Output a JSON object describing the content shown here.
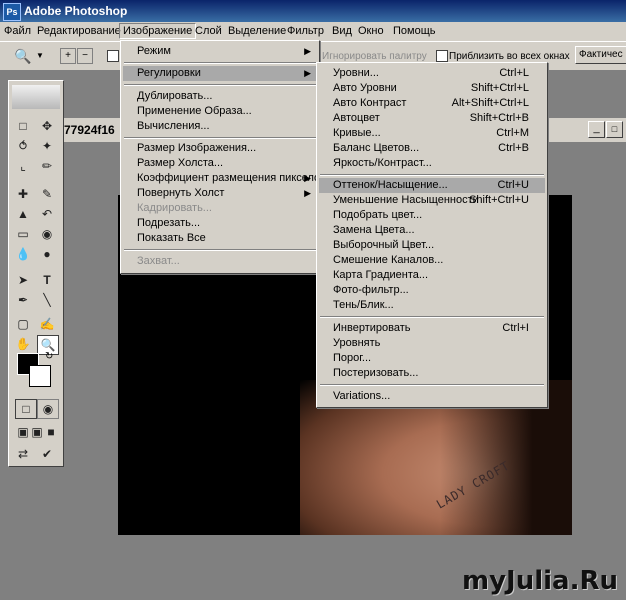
{
  "app_title": "Adobe Photoshop",
  "menubar": [
    "Файл",
    "Редактирование",
    "Изображение",
    "Слой",
    "Выделение",
    "Фильтр",
    "Вид",
    "Окно",
    "Помощь"
  ],
  "options_bar": {
    "ignore_palettes": "Игнорировать палитру",
    "fit_windows": "Приблизить во всех окнах",
    "actual_pixels": "Фактичес"
  },
  "document_title": "77924f16",
  "image_menu": {
    "items": [
      {
        "label": "Режим",
        "submenu": true
      },
      {
        "label": "Регулировки",
        "submenu": true,
        "highlighted": true
      },
      {
        "label": "Дублировать..."
      },
      {
        "label": "Применение Образа..."
      },
      {
        "label": "Вычисления..."
      },
      {
        "label": "Размер Изображения..."
      },
      {
        "label": "Размер Холста..."
      },
      {
        "label": "Коэффициент размещения пикселов",
        "submenu": true
      },
      {
        "label": "Повернуть Холст",
        "submenu": true
      },
      {
        "label": "Кадрировать...",
        "disabled": true
      },
      {
        "label": "Подрезать..."
      },
      {
        "label": "Показать Все"
      },
      {
        "label": "Захват...",
        "disabled": true
      }
    ]
  },
  "adjustments_menu": {
    "items": [
      {
        "label": "Уровни...",
        "shortcut": "Ctrl+L"
      },
      {
        "label": "Авто Уровни",
        "shortcut": "Shift+Ctrl+L"
      },
      {
        "label": "Авто Контраст",
        "shortcut": "Alt+Shift+Ctrl+L"
      },
      {
        "label": "Автоцвет",
        "shortcut": "Shift+Ctrl+B"
      },
      {
        "label": "Кривые...",
        "shortcut": "Ctrl+M"
      },
      {
        "label": "Баланс Цветов...",
        "shortcut": "Ctrl+B"
      },
      {
        "label": "Яркость/Контраст...",
        "shortcut": ""
      },
      {
        "label": "Оттенок/Насыщение...",
        "shortcut": "Ctrl+U",
        "highlighted": true
      },
      {
        "label": "Уменьшение Насыщенности",
        "shortcut": "Shift+Ctrl+U"
      },
      {
        "label": "Подобрать цвет...",
        "shortcut": ""
      },
      {
        "label": "Замена Цвета...",
        "shortcut": ""
      },
      {
        "label": "Выборочный Цвет...",
        "shortcut": ""
      },
      {
        "label": "Смешение Каналов...",
        "shortcut": ""
      },
      {
        "label": "Карта Градиента...",
        "shortcut": ""
      },
      {
        "label": "Фото-фильтр...",
        "shortcut": ""
      },
      {
        "label": "Тень/Блик...",
        "shortcut": ""
      },
      {
        "label": "Инвертировать",
        "shortcut": "Ctrl+I"
      },
      {
        "label": "Уровнять",
        "shortcut": ""
      },
      {
        "label": "Порог...",
        "shortcut": ""
      },
      {
        "label": "Постеризовать...",
        "shortcut": ""
      },
      {
        "label": "Variations...",
        "shortcut": ""
      }
    ]
  },
  "tattoo_text": "LADY CROFT",
  "watermark": "myJulia.Ru",
  "colors": {
    "title_bar": "#0a246a",
    "menu_bg": "#d4d0c8",
    "highlight": "#a9a9a9"
  }
}
